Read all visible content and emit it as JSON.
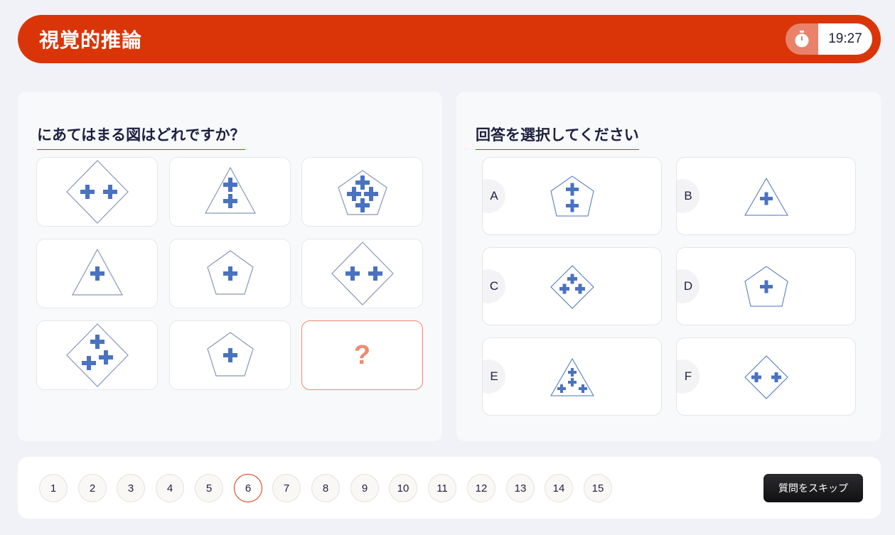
{
  "header": {
    "title": "視覚的推論",
    "timer": "19:27",
    "timer_icon": "stopwatch-icon"
  },
  "question": {
    "heading": "にあてはまる図はどれですか？",
    "missing_mark": "?"
  },
  "answers": {
    "heading": "回答を選択してください",
    "options": [
      {
        "letter": "A",
        "shape": "pentagon",
        "crosses": 2
      },
      {
        "letter": "B",
        "shape": "triangle",
        "crosses": 1
      },
      {
        "letter": "C",
        "shape": "diamond",
        "crosses": 3
      },
      {
        "letter": "D",
        "shape": "pentagon",
        "crosses": 1
      },
      {
        "letter": "E",
        "shape": "triangle",
        "crosses": 4
      },
      {
        "letter": "F",
        "shape": "diamond",
        "crosses": 2
      }
    ]
  },
  "grid": [
    {
      "shape": "diamond",
      "crosses": 2
    },
    {
      "shape": "triangle",
      "crosses": 2
    },
    {
      "shape": "pentagon",
      "crosses": 4
    },
    {
      "shape": "triangle",
      "crosses": 1
    },
    {
      "shape": "pentagon",
      "crosses": 1
    },
    {
      "shape": "diamond",
      "crosses": 2
    },
    {
      "shape": "diamond",
      "crosses": 3
    },
    {
      "shape": "pentagon",
      "crosses": 1
    }
  ],
  "pagination": {
    "pages": [
      "1",
      "2",
      "3",
      "4",
      "5",
      "6",
      "7",
      "8",
      "9",
      "10",
      "11",
      "12",
      "13",
      "14",
      "15"
    ],
    "current": "6"
  },
  "skip_label": "質問をスキップ",
  "colors": {
    "accent": "#da3508",
    "cross": "#4a72c0",
    "outline": "#8897b8",
    "question_mark": "#f08a6c"
  }
}
